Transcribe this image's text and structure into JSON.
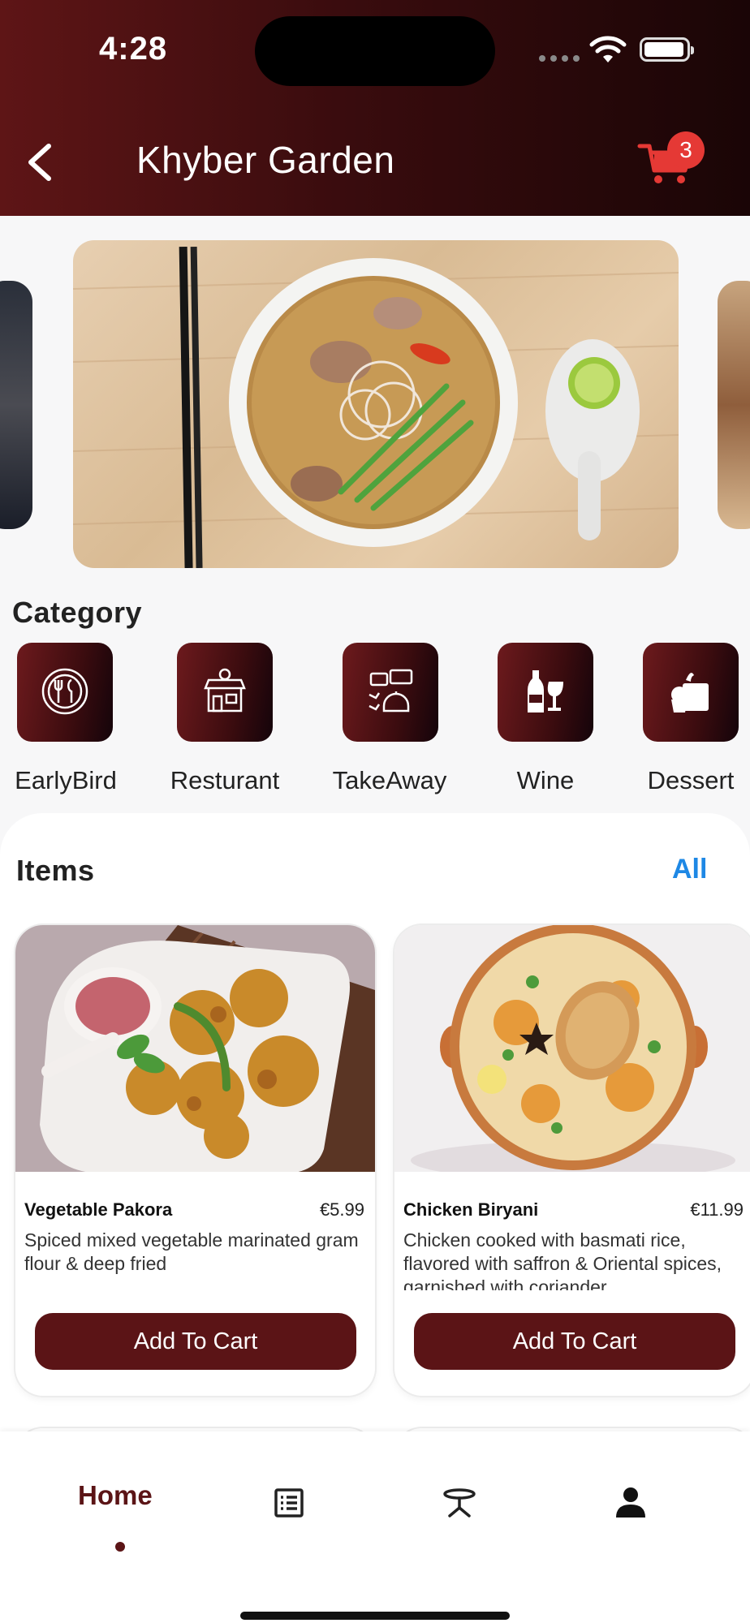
{
  "status_bar": {
    "time": "4:28"
  },
  "header": {
    "title": "Khyber Garden",
    "cart_count": "3"
  },
  "category": {
    "title": "Category",
    "items": [
      {
        "label": "EarlyBird",
        "icon": "plate-cutlery-icon"
      },
      {
        "label": "Resturant",
        "icon": "restaurant-icon"
      },
      {
        "label": "TakeAway",
        "icon": "takeaway-icon"
      },
      {
        "label": "Wine",
        "icon": "wine-icon"
      },
      {
        "label": "Dessert",
        "icon": "dessert-icon"
      }
    ]
  },
  "items": {
    "title": "Items",
    "all_label": "All",
    "cards": [
      {
        "name": "Vegetable Pakora",
        "price": "€5.99",
        "description": "Spiced mixed vegetable marinated gram flour & deep fried",
        "button": "Add To Cart"
      },
      {
        "name": "Chicken Biryani",
        "price": "€11.99",
        "description": "Chicken cooked with basmati rice, flavored with saffron & Oriental spices, garnished with coriander",
        "button": "Add To Cart"
      }
    ]
  },
  "bottom_nav": {
    "home_label": "Home",
    "tabs": [
      "home",
      "menu-list-icon",
      "table-icon",
      "profile-icon"
    ]
  },
  "colors": {
    "brand": "#5b1416",
    "accent_link": "#1e88e5",
    "badge": "#e53935"
  }
}
